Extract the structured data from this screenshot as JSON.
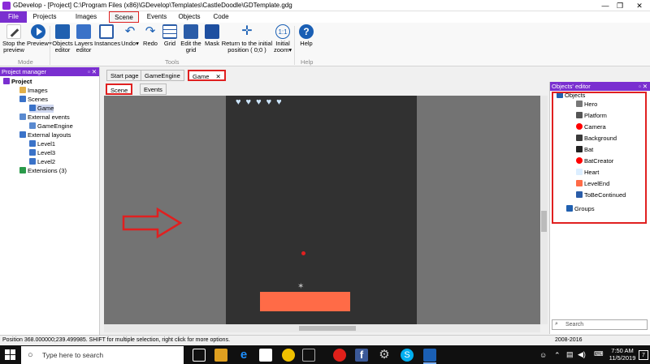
{
  "window": {
    "title": "GDevelop - [Project] C:\\Program Files (x86)\\GDevelop\\Templates\\CastleDoodle\\GDTemplate.gdg",
    "minimize": "—",
    "maximize": "❐",
    "close": "✕"
  },
  "menu": {
    "file": "File",
    "projects": "Projects",
    "images_bank": "Images bank",
    "scene": "Scene",
    "events": "Events",
    "objects": "Objects",
    "code": "Code"
  },
  "ribbon": {
    "stop_preview": "Stop the preview",
    "preview": "Preview",
    "objects_editor": "Objects editor",
    "layers_editor": "Layers editor",
    "instances": "Instances",
    "undo": "Undo",
    "redo": "Redo",
    "grid": "Grid",
    "edit_grid": "Edit the grid",
    "mask": "Mask",
    "return_initial": "Return to the initial position ( 0;0 )",
    "initial_zoom": "Initial zoom",
    "help": "Help",
    "group_mode": "Mode",
    "group_tools": "Tools",
    "group_help": "Help"
  },
  "project_manager": {
    "header": "Project manager",
    "project": "Project",
    "images": "Images",
    "scenes": "Scenes",
    "scene_game": "Game",
    "external_events": "External events",
    "ext_event_gameengine": "GameEngine",
    "external_layouts": "External layouts",
    "level1": "Level1",
    "level3": "Level3",
    "level2": "Level2",
    "extensions": "Extensions (3)"
  },
  "doc_tabs": {
    "start_page": "Start page",
    "gameengine": "GameEngine",
    "game": "Game",
    "game_close": "✕"
  },
  "sub_tabs": {
    "scene": "Scene",
    "events": "Events"
  },
  "scene": {
    "hearts": [
      "♥",
      "♥",
      "♥",
      "♥",
      "♥"
    ]
  },
  "objects_editor": {
    "header": "Objects' editor",
    "root": "Objects",
    "items": [
      "Hero",
      "Platform",
      "Camera",
      "Background",
      "Bat",
      "BatCreator",
      "Heart",
      "LevelEnd",
      "ToBeContinued"
    ],
    "groups": "Groups",
    "search_placeholder": "Search"
  },
  "statusbar": {
    "text": "Position 368.000000;239.499985. SHIFT for multiple selection, right click for more options.",
    "years": "2008-2016"
  },
  "taskbar": {
    "search_placeholder": "Type here to search",
    "time": "7:50 AM",
    "date": "11/5/2019",
    "notification_count": "7"
  },
  "colors": {
    "accent": "#7a2fd0",
    "highlight": "#e02020",
    "platform": "#ff6b47",
    "canvas": "#313131"
  }
}
